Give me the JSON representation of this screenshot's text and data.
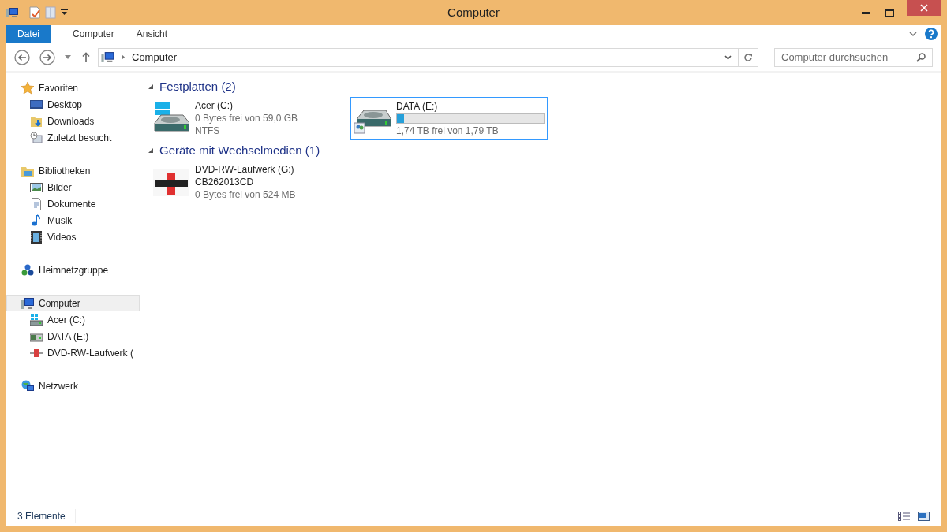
{
  "window": {
    "title": "Computer"
  },
  "ribbon_tabs": [
    {
      "label": "Datei",
      "selected": true
    },
    {
      "label": "Computer",
      "selected": false
    },
    {
      "label": "Ansicht",
      "selected": false
    }
  ],
  "address": {
    "path": "Computer"
  },
  "search": {
    "placeholder": "Computer durchsuchen"
  },
  "sidebar": {
    "groups": [
      {
        "label": "Favoriten",
        "kind": "star",
        "selected": false,
        "children": [
          {
            "label": "Desktop",
            "kind": "desktop",
            "selected": false
          },
          {
            "label": "Downloads",
            "kind": "downloads",
            "selected": false
          },
          {
            "label": "Zuletzt besucht",
            "kind": "recent",
            "selected": false
          }
        ]
      },
      {
        "label": "Bibliotheken",
        "kind": "library",
        "selected": false,
        "children": [
          {
            "label": "Bilder",
            "kind": "pictures",
            "selected": false
          },
          {
            "label": "Dokumente",
            "kind": "document",
            "selected": false
          },
          {
            "label": "Musik",
            "kind": "music",
            "selected": false
          },
          {
            "label": "Videos",
            "kind": "video",
            "selected": false
          }
        ]
      },
      {
        "label": "Heimnetzgruppe",
        "kind": "homegroup",
        "selected": false
      },
      {
        "label": "Computer",
        "kind": "computer",
        "selected": true,
        "children": [
          {
            "label": "Acer (C:)",
            "kind": "windrive",
            "selected": false
          },
          {
            "label": "DATA (E:)",
            "kind": "netdrive",
            "selected": false
          },
          {
            "label": "DVD-RW-Laufwerk (",
            "kind": "dvd",
            "selected": false
          }
        ]
      },
      {
        "label": "Netzwerk",
        "kind": "network",
        "selected": false
      }
    ]
  },
  "sections": [
    {
      "title": "Festplatten (2)",
      "expanded": true,
      "items": [
        {
          "kind": "windows-drive",
          "name": "Acer (C:)",
          "details": [
            "0 Bytes frei von 59,0 GB",
            "NTFS"
          ],
          "selected": false
        },
        {
          "kind": "shared-drive",
          "name": "DATA (E:)",
          "level": 0.05,
          "details": [
            "1,74 TB frei von 1,79 TB"
          ],
          "selected": true
        }
      ]
    },
    {
      "title": "Geräte mit Wechselmedien (1)",
      "expanded": true,
      "items": [
        {
          "kind": "dvd",
          "name": "DVD-RW-Laufwerk (G:)",
          "details": [
            "CB262013CD",
            "0 Bytes frei von 524 MB"
          ],
          "selected": false
        }
      ]
    }
  ],
  "status_bar": {
    "count": "3 Elemente"
  }
}
